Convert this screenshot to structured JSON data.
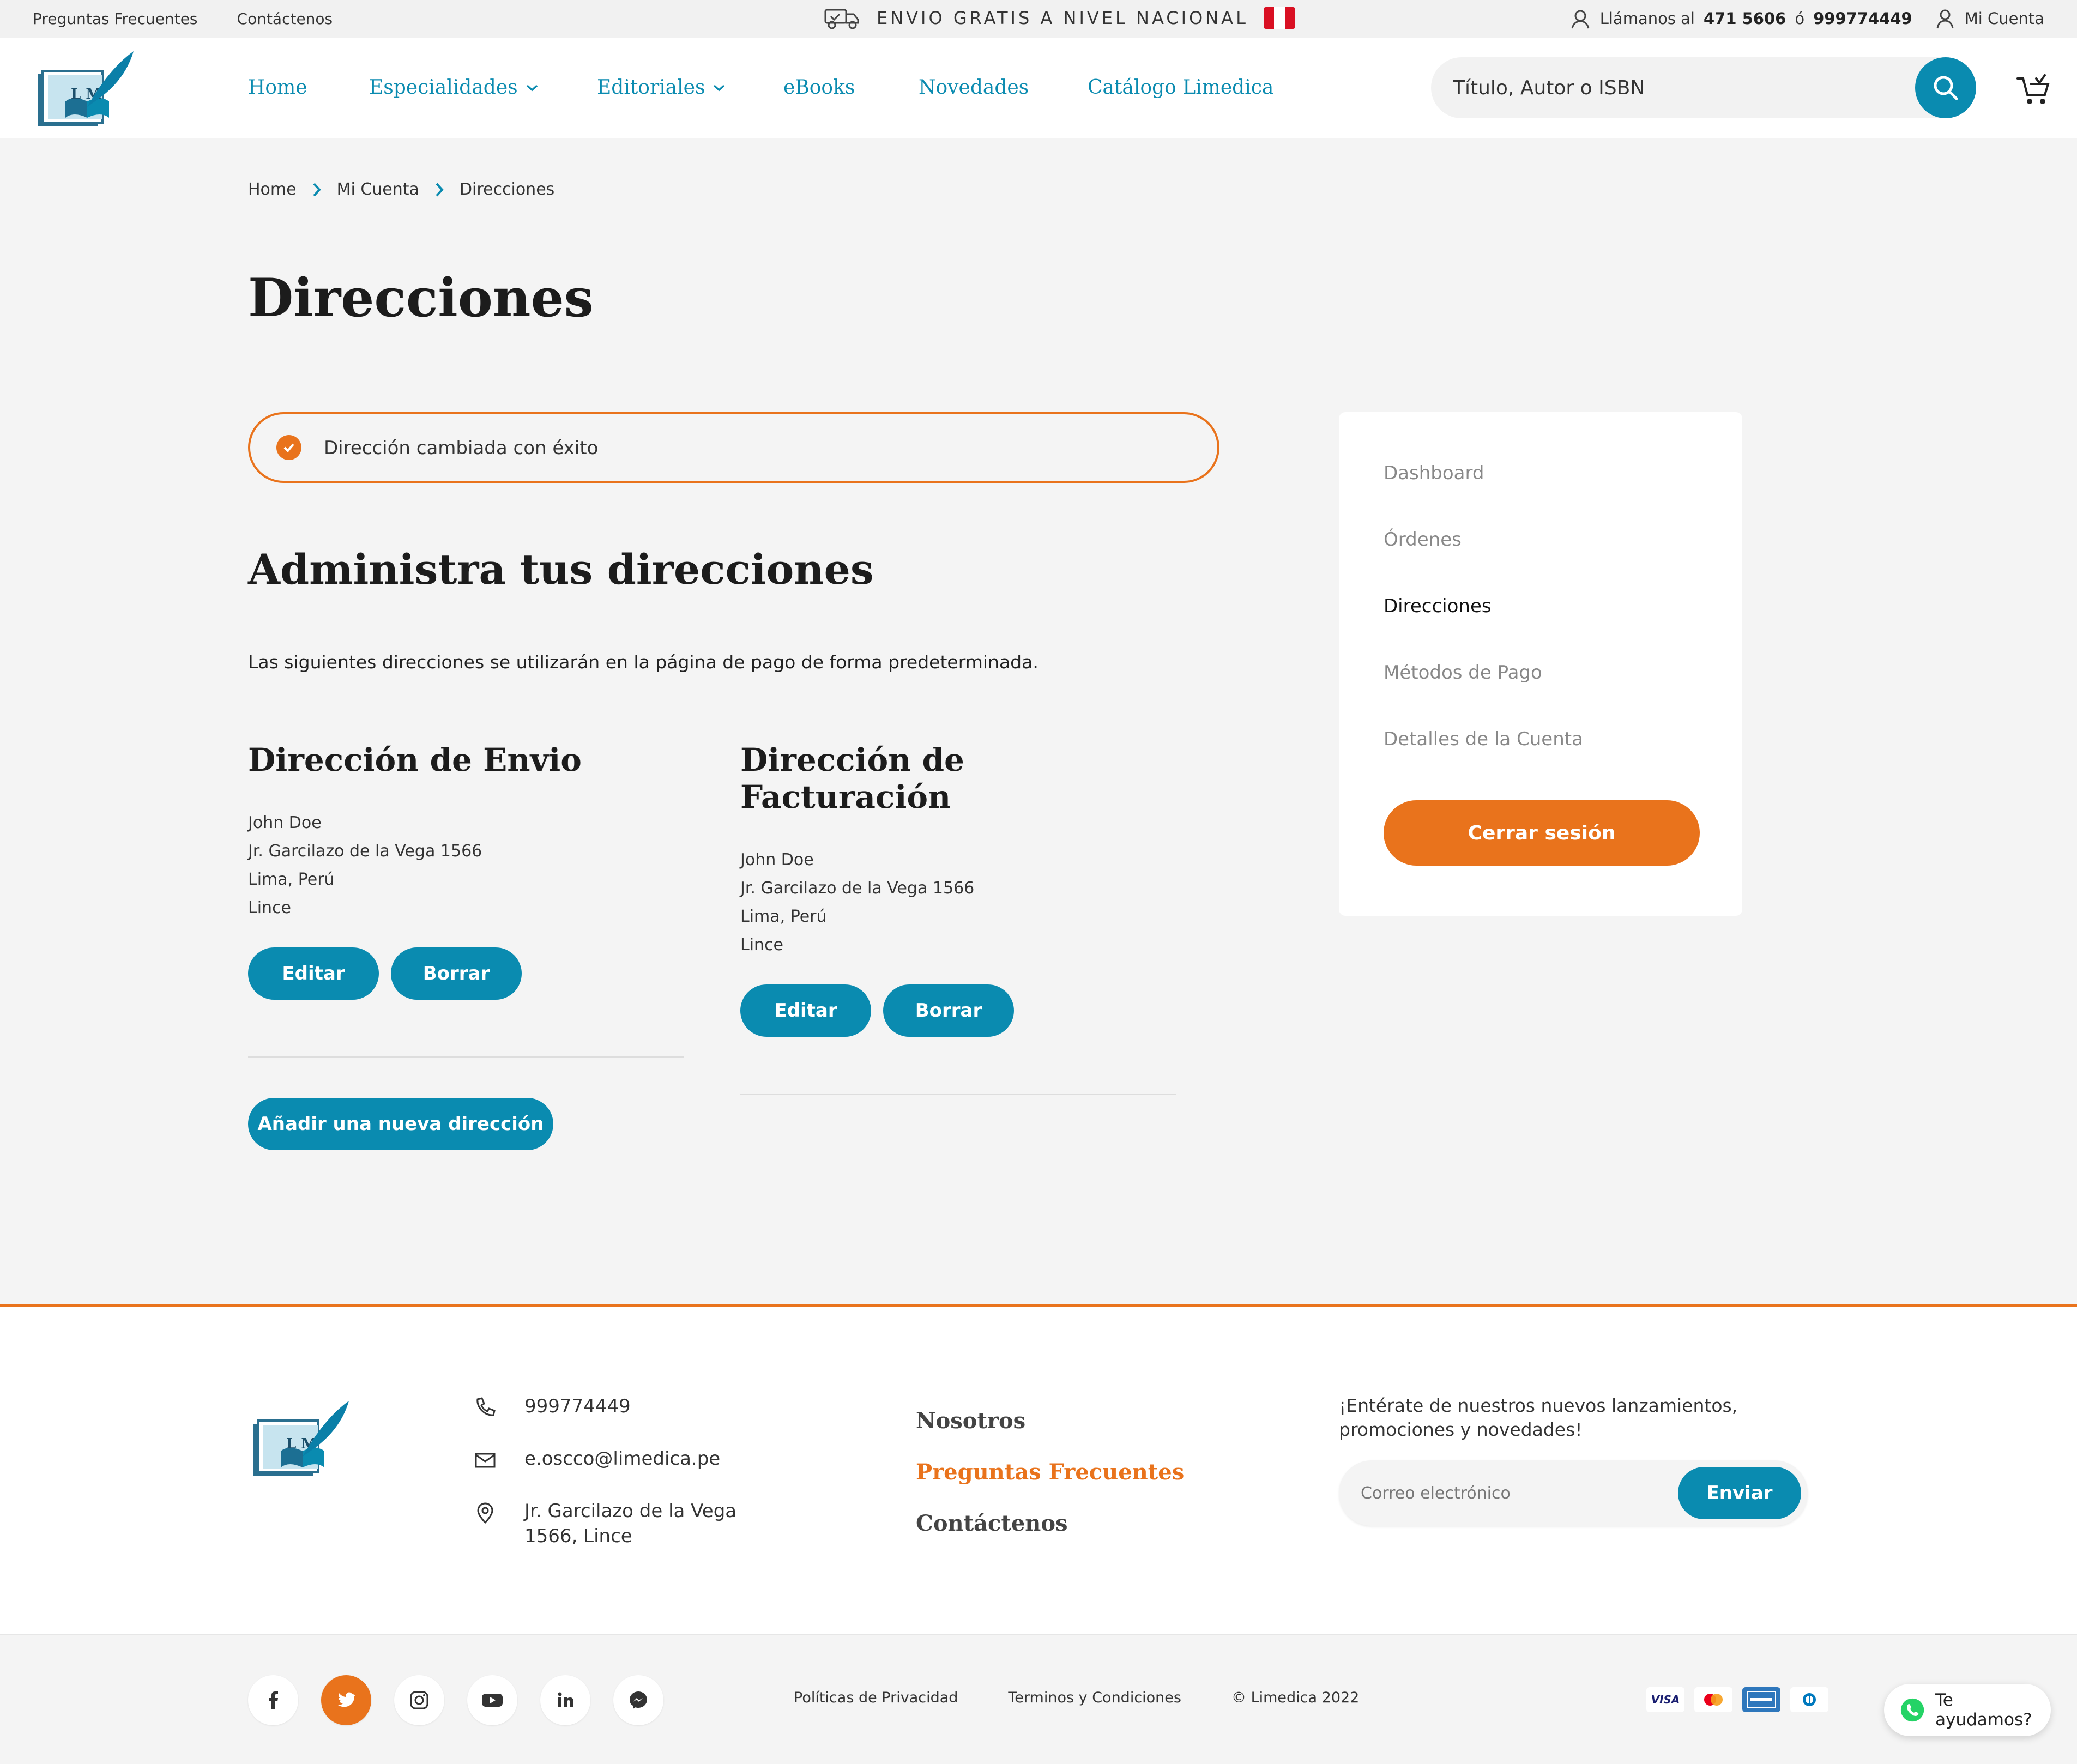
{
  "topbar": {
    "faq_link": "Preguntas Frecuentes",
    "contact_link": "Contáctenos",
    "shipping_banner": "ENVIO GRATIS A NIVEL NACIONAL",
    "call_label": "Llámanos al",
    "phone_1": "471 5606",
    "or": "ó",
    "phone_2": "999774449",
    "account_link": "Mi Cuenta"
  },
  "header": {
    "logo_text": "L M",
    "nav": [
      {
        "label": "Home"
      },
      {
        "label": "Especialidades"
      },
      {
        "label": "Editoriales"
      },
      {
        "label": "eBooks"
      },
      {
        "label": "Novedades"
      },
      {
        "label": "Catálogo Limedica"
      }
    ],
    "search_placeholder": "Título, Autor o ISBN"
  },
  "breadcrumb": [
    "Home",
    "Mi Cuenta",
    "Direcciones"
  ],
  "page_title": "Direcciones",
  "alert": {
    "message": "Dirección cambiada con éxito"
  },
  "section_title": "Administra tus direcciones",
  "description": "Las siguientes direcciones se utilizarán en la página de pago de forma predeterminada.",
  "shipping": {
    "title": "Dirección de Envio",
    "lines": [
      "John Doe",
      "Jr. Garcilazo de la Vega 1566",
      "Lima, Perú",
      "Lince"
    ],
    "edit_label": "Editar",
    "delete_label": "Borrar"
  },
  "billing": {
    "title": "Dirección de Facturación",
    "lines": [
      "John Doe",
      "Jr. Garcilazo de la Vega 1566",
      "Lima, Perú",
      "Lince"
    ],
    "edit_label": "Editar",
    "delete_label": "Borrar"
  },
  "add_address_label": "Añadir una nueva dirección",
  "sidebar": {
    "items": [
      {
        "label": "Dashboard"
      },
      {
        "label": "Órdenes"
      },
      {
        "label": "Direcciones"
      },
      {
        "label": "Métodos de Pago"
      },
      {
        "label": "Detalles de la Cuenta"
      }
    ],
    "logout_label": "Cerrar sesión"
  },
  "footer": {
    "phone": "999774449",
    "email": "e.oscco@limedica.pe",
    "address_line1": "Jr. Garcilazo de la Vega",
    "address_line2": "1566, Lince",
    "links": [
      "Nosotros",
      "Preguntas Frecuentes",
      "Contáctenos"
    ],
    "newsletter_text": "¡Entérate de nuestros nuevos lanzamientos, promociones y novedades!",
    "newsletter_placeholder": "Correo electrónico",
    "newsletter_button": "Enviar"
  },
  "bottom": {
    "privacy": "Políticas de Privacidad",
    "terms": "Terminos y Condiciones",
    "copyright": "© Limedica 2022",
    "payment_cards": [
      "VISA",
      "Mastercard",
      "American Express",
      "Diners Club"
    ],
    "whatsapp_label": "Te ayudamos?"
  },
  "colors": {
    "primary": "#0a8bb0",
    "accent": "#e9731c",
    "background": "#f4f4f4"
  }
}
